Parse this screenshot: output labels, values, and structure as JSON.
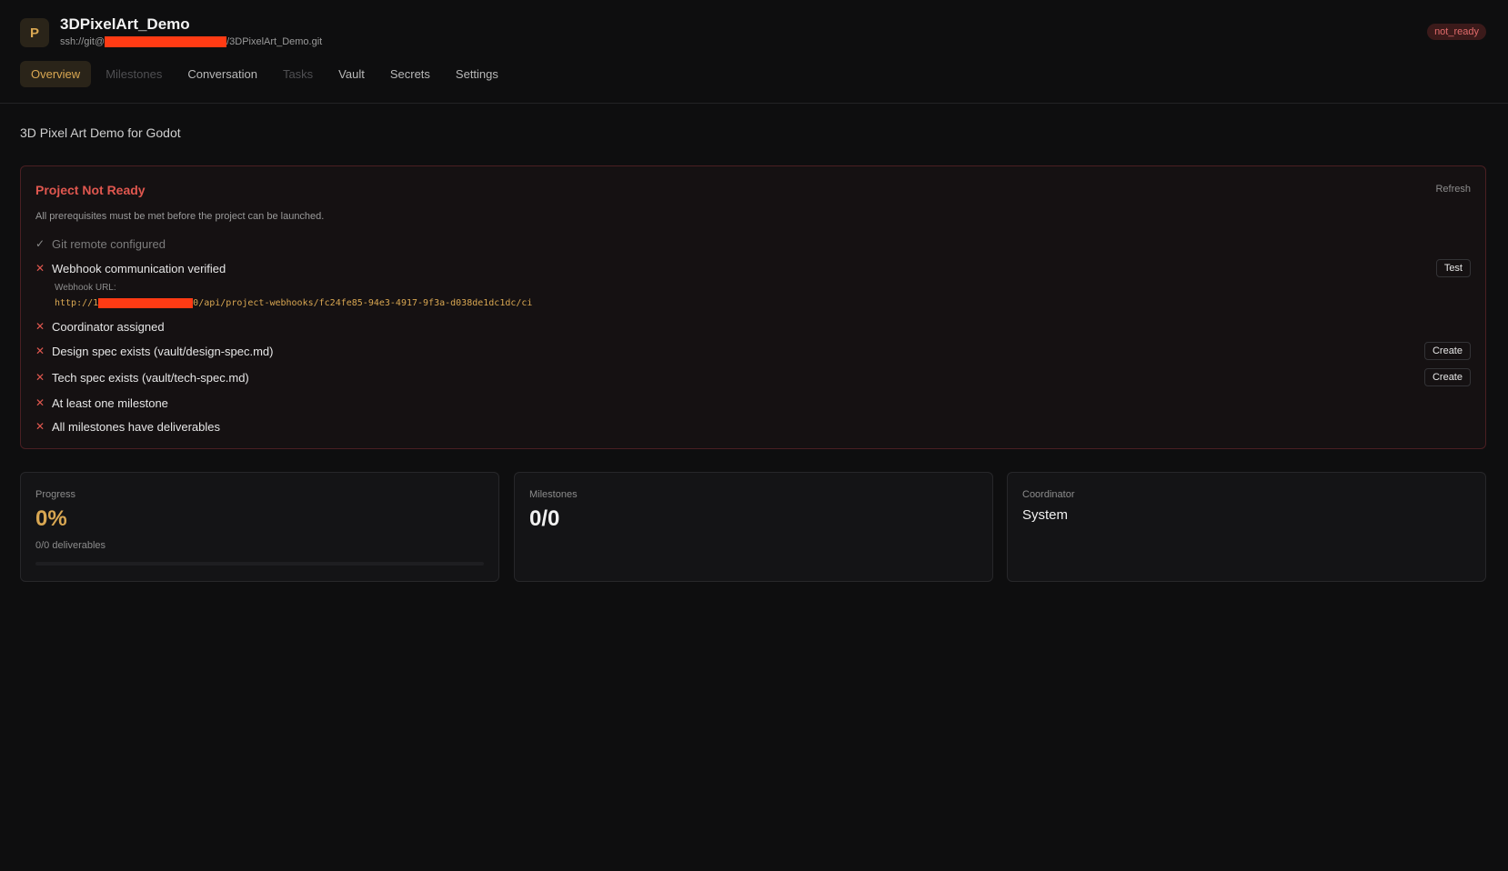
{
  "project": {
    "avatar_letter": "P",
    "name": "3DPixelArt_Demo",
    "repo_prefix": "ssh://git@",
    "repo_suffix": "/3DPixelArt_Demo.git",
    "status": "not_ready",
    "description": "3D Pixel Art Demo for Godot"
  },
  "tabs": [
    {
      "label": "Overview",
      "state": "active"
    },
    {
      "label": "Milestones",
      "state": "disabled"
    },
    {
      "label": "Conversation",
      "state": "normal"
    },
    {
      "label": "Tasks",
      "state": "disabled"
    },
    {
      "label": "Vault",
      "state": "normal"
    },
    {
      "label": "Secrets",
      "state": "normal"
    },
    {
      "label": "Settings",
      "state": "normal"
    }
  ],
  "readiness": {
    "title": "Project Not Ready",
    "refresh_label": "Refresh",
    "description": "All prerequisites must be met before the project can be launched.",
    "checks": [
      {
        "label": "Git remote configured",
        "ok": true,
        "mark": "✓"
      },
      {
        "label": "Webhook communication verified",
        "ok": false,
        "mark": "✕",
        "action": "Test"
      },
      {
        "label": "Coordinator assigned",
        "ok": false,
        "mark": "✕"
      },
      {
        "label": "Design spec exists (vault/design-spec.md)",
        "ok": false,
        "mark": "✕",
        "action": "Create"
      },
      {
        "label": "Tech spec exists (vault/tech-spec.md)",
        "ok": false,
        "mark": "✕",
        "action": "Create"
      },
      {
        "label": "At least one milestone",
        "ok": false,
        "mark": "✕"
      },
      {
        "label": "All milestones have deliverables",
        "ok": false,
        "mark": "✕"
      }
    ],
    "webhook_label": "Webhook URL:",
    "webhook_url_prefix": "http://1",
    "webhook_url_suffix": "0/api/project-webhooks/fc24fe85-94e3-4917-9f3a-d038de1dc1dc/ci"
  },
  "stats": {
    "progress": {
      "label": "Progress",
      "value": "0%",
      "sub": "0/0 deliverables",
      "fraction": 0
    },
    "milestones": {
      "label": "Milestones",
      "value": "0/0"
    },
    "coordinator": {
      "label": "Coordinator",
      "value": "System"
    }
  },
  "colors": {
    "accent": "#d9a752",
    "error": "#e0574f",
    "background": "#0e0e0f",
    "redaction": "#ff3b14"
  }
}
